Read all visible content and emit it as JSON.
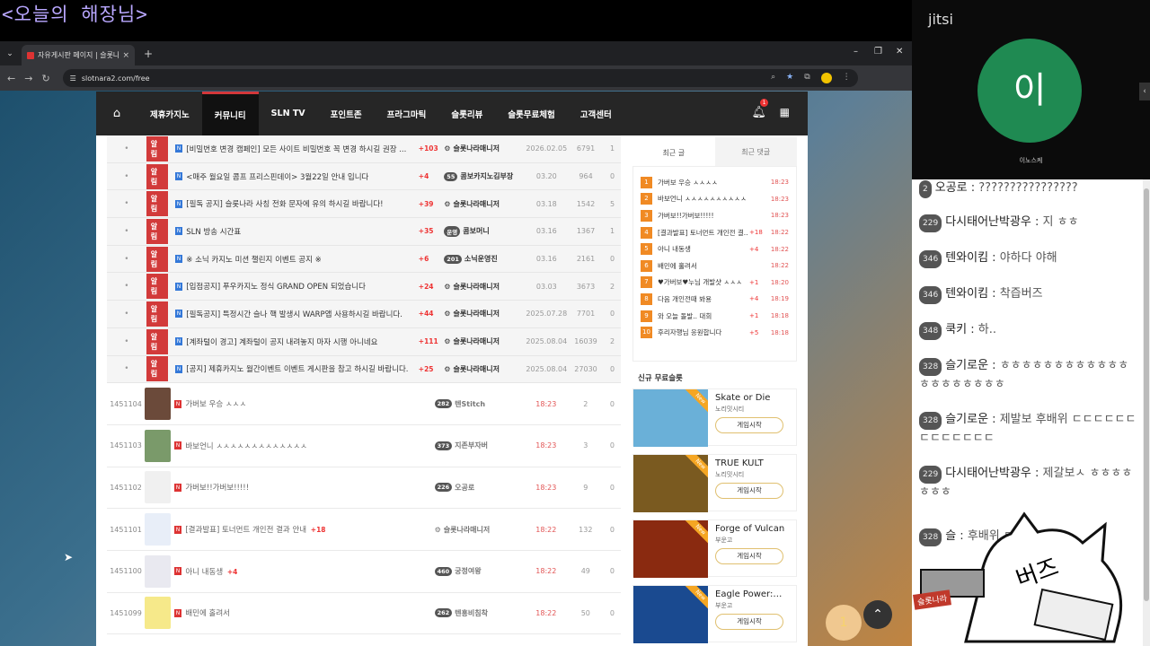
{
  "stream_title": "<오늘의 해장님>",
  "browser": {
    "tab_title": "자유게시판 페이지 | 슬롯나라",
    "tab_close": "×",
    "new_tab": "+",
    "url": "slotnara2.com/free",
    "win_min": "–",
    "win_max": "❐",
    "win_close": "✕"
  },
  "nav": {
    "home": "⌂",
    "items": [
      "제휴카지노",
      "커뮤니티",
      "SLN TV",
      "포인트존",
      "프라그마틱",
      "슬롯리뷰",
      "슬롯무료체험",
      "고객센터"
    ],
    "active_index": 1,
    "bell_badge": "1"
  },
  "notice_tag": "알림",
  "notices": [
    {
      "title": "[비밀번호 변경 캠페인] 모든 사이트 비밀번호 꼭 변경 하시길 권장 ...",
      "count": "+103",
      "author": "슬롯나라매니저",
      "date": "2026.02.05",
      "views": "6791",
      "likes": "1"
    },
    {
      "title": "<매주 월요일 콤프 프리스핀데이> 3월22일 안내 입니다",
      "count": "+4",
      "level": "55",
      "author": "콤보카지노김부장",
      "date": "03.20",
      "views": "964",
      "likes": "0"
    },
    {
      "title": "[필독 공지] 슬롯나라 사칭 전화 문자에 유의 하시길 바랍니다!",
      "count": "+39",
      "author": "슬롯나라매니저",
      "date": "03.18",
      "views": "1542",
      "likes": "5"
    },
    {
      "title": "SLN 방송 시간표",
      "count": "+35",
      "level": "운영",
      "author": "콤보머니",
      "date": "03.16",
      "views": "1367",
      "likes": "1"
    },
    {
      "title": "※ 소닉 카지노 미션 챌린지 이벤트 공지 ※",
      "count": "+6",
      "level": "201",
      "author": "소닉운영진",
      "date": "03.16",
      "views": "2161",
      "likes": "0"
    },
    {
      "title": "[입점공지] 푸우카지노 정식 GRAND OPEN 되었습니다",
      "count": "+24",
      "author": "슬롯나라매니저",
      "date": "03.03",
      "views": "3673",
      "likes": "2"
    },
    {
      "title": "[필독공지] 특정시간 슬나 핵 발생시 WARP앱 사용하시길 바랍니다.",
      "count": "+44",
      "author": "슬롯나라매니저",
      "date": "2025.07.28",
      "views": "7701",
      "likes": "0"
    },
    {
      "title": "[계좌털이 경고] 계좌털이 공지 내려놓지 마자 시행 아니네요",
      "count": "+111",
      "author": "슬롯나라매니저",
      "date": "2025.08.04",
      "views": "16039",
      "likes": "2"
    },
    {
      "title": "[공지] 제휴카지노 월간이벤트 이벤트 게시판을 참고 하시길 바랍니다.",
      "count": "+25",
      "author": "슬롯나라매니저",
      "date": "2025.08.04",
      "views": "27030",
      "likes": "0"
    }
  ],
  "posts": [
    {
      "id": "1451104",
      "title": "가버보 우승 ㅅㅅㅅ",
      "count": "",
      "level": "282",
      "author": "텐Stitch",
      "date": "18:23",
      "views": "2",
      "likes": "0",
      "thumb": "#6b4a3a"
    },
    {
      "id": "1451103",
      "title": "바보언니 ㅅㅅㅅㅅㅅㅅㅅㅅㅅㅅㅅㅅㅅ",
      "count": "",
      "level": "373",
      "author": "지존부자버",
      "date": "18:23",
      "views": "3",
      "likes": "0",
      "thumb": "#7a9a6a"
    },
    {
      "id": "1451102",
      "title": "가버보!!가버보!!!!!",
      "count": "",
      "level": "226",
      "author": "오공로",
      "date": "18:23",
      "views": "9",
      "likes": "0",
      "thumb": "#f0f0f0"
    },
    {
      "id": "1451101",
      "title": "[결과발표] 토너먼트 개인전 결과 안내",
      "count": "+18",
      "level": "",
      "author": "슬롯나라매니저",
      "date": "18:22",
      "views": "132",
      "likes": "0",
      "thumb": "#e8eef8"
    },
    {
      "id": "1451100",
      "title": "아니 내동생",
      "count": "+4",
      "level": "460",
      "author": "궁정여왕",
      "date": "18:22",
      "views": "49",
      "likes": "0",
      "thumb": "#e9e9f0"
    },
    {
      "id": "1451099",
      "title": "배민에 홀려서",
      "count": "",
      "level": "262",
      "author": "텐흥비침착",
      "date": "18:22",
      "views": "50",
      "likes": "0",
      "thumb": "#f6e98a"
    }
  ],
  "sidebar": {
    "tabs": [
      "최근 글",
      "최근 댓글"
    ],
    "recent": [
      {
        "n": "1",
        "t": "가버보 우승 ㅅㅅㅅㅅ",
        "c": "",
        "time": "18:23"
      },
      {
        "n": "2",
        "t": "바보언니 ㅅㅅㅅㅅㅅㅅㅅㅅㅅㅅㅅㅅ",
        "c": "",
        "time": "18:23"
      },
      {
        "n": "3",
        "t": "가버보!!가버보!!!!!",
        "c": "",
        "time": "18:23"
      },
      {
        "n": "4",
        "t": "[결과발표] 토너먼트 개인전 결...",
        "c": "+18",
        "time": "18:22"
      },
      {
        "n": "5",
        "t": "아니 내동생",
        "c": "+4",
        "time": "18:22"
      },
      {
        "n": "6",
        "t": "배민에 홀려서",
        "c": "",
        "time": "18:22"
      },
      {
        "n": "7",
        "t": "♥가버보♥누님 개발샷 ㅅㅅㅅ",
        "c": "+1",
        "time": "18:20"
      },
      {
        "n": "8",
        "t": "다음 개인전때 봐용",
        "c": "+4",
        "time": "18:19"
      },
      {
        "n": "9",
        "t": "와 오늘 돌발.. 대회",
        "c": "+1",
        "time": "18:18"
      },
      {
        "n": "10",
        "t": "후리자행님 응원합니다",
        "c": "+5",
        "time": "18:18"
      }
    ],
    "slots_title": "신규 무료슬롯",
    "slots": [
      {
        "name": "Skate or Die",
        "provider": "노리밋시티",
        "play": "게임시작",
        "new": "New",
        "color": "#6ab0d8"
      },
      {
        "name": "TRUE KULT",
        "provider": "노리밋시티",
        "play": "게임시작",
        "new": "New",
        "color": "#7a5a20"
      },
      {
        "name": "Forge of Vulcan",
        "provider": "부운고",
        "play": "게임시작",
        "new": "New",
        "color": "#8a2a10"
      },
      {
        "name": "Eagle Power:…",
        "provider": "부운고",
        "play": "게임시작",
        "new": "New",
        "color": "#1a4a90"
      }
    ]
  },
  "fab": {
    "chat": "1",
    "top": "⌃"
  },
  "jitsi": {
    "logo": "jitsi",
    "avatar": "이",
    "name": "이노스케"
  },
  "chat": [
    {
      "level": "2",
      "nick": "오공로",
      "text": "????????????????"
    },
    {
      "level": "229",
      "nick": "다시태어난박광우",
      "text": "지 ㅎㅎ"
    },
    {
      "level": "346",
      "nick": "텐와이킴",
      "text": "야하다 야해"
    },
    {
      "level": "346",
      "nick": "텐와이킴",
      "text": "착즙버즈"
    },
    {
      "level": "348",
      "nick": "쿡키",
      "text": "하.."
    },
    {
      "level": "328",
      "nick": "슬기로운",
      "text": "ㅎㅎㅎㅎㅎㅎㅎㅎㅎㅎㅎㅎㅎㅎㅎㅎㅎㅎㅎㅎ"
    },
    {
      "level": "328",
      "nick": "슬기로운",
      "text": "제발보 후배위 ㄷㄷㄷㄷㄷㄷㄷㄷㄷㄷㄷㄷㄷ"
    },
    {
      "level": "229",
      "nick": "다시태어난박광우",
      "text": "제갈보ㅅ ㅎㅎㅎㅎㅎㅎㅎ"
    },
    {
      "level": "328",
      "nick": "슬",
      "text": "후배위 ㄷㄷㄷ"
    }
  ],
  "overlay": {
    "cat_text": "버즈",
    "logo": "슬롯나라"
  }
}
